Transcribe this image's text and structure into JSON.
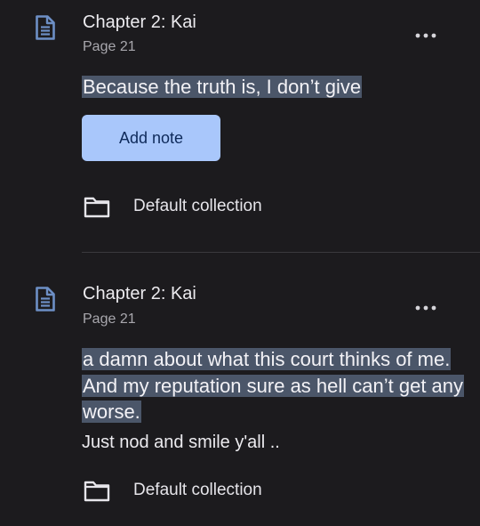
{
  "colors": {
    "background": "#1c1b1e",
    "highlight": "#4b5669",
    "accent_button": "#a9c7fb",
    "icon_blue": "#6d8fc5"
  },
  "notes": [
    {
      "icon": "document-icon",
      "chapter": "Chapter 2: Kai",
      "page": "Page 21",
      "highlight": "Because the truth is, I don’t give",
      "action_button": "Add note",
      "more_icon": "more-horizontal-icon",
      "collection_icon": "folder-icon",
      "collection": "Default collection"
    },
    {
      "icon": "document-icon",
      "chapter": "Chapter 2: Kai",
      "page": "Page 21",
      "highlight": "a damn about what this court thinks of me. And my reputation sure as hell can’t get any worse.",
      "note": "Just nod and smile y'all ..",
      "more_icon": "more-horizontal-icon",
      "collection_icon": "folder-icon",
      "collection": "Default collection"
    }
  ]
}
